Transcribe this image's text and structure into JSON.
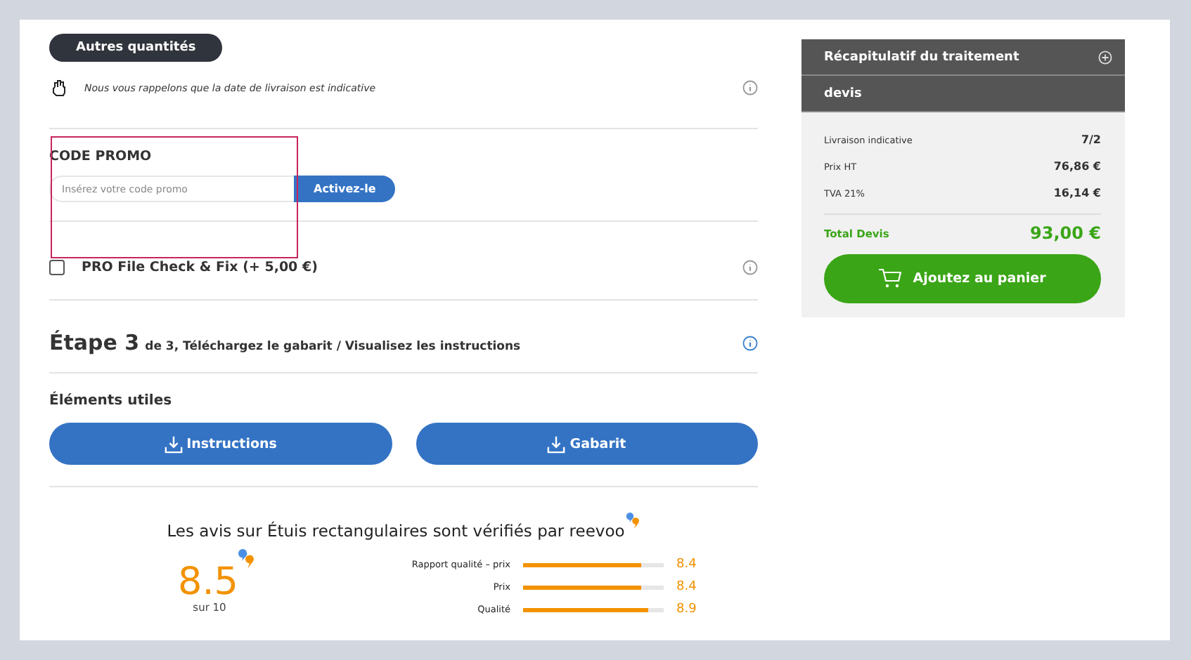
{
  "quantities_button": "Autres quantités",
  "notice": "Nous vous rappelons que la date de livraison est indicative",
  "promo": {
    "title": "CODE PROMO",
    "placeholder": "Insérez votre code promo",
    "button": "Activez-le",
    "highlighted": true
  },
  "option": {
    "label": "PRO File Check & Fix (+ 5,00 €)",
    "checked": false
  },
  "step": {
    "number": "Étape 3",
    "subtitle": "de 3, Téléchargez le gabarit / Visualisez les instructions"
  },
  "useful": {
    "title": "Éléments utiles",
    "buttons": [
      "Instructions",
      "Gabarit"
    ]
  },
  "reviews": {
    "title": "Les avis sur Étuis rectangulaires sont vérifiés par reevoo",
    "score": "8.5",
    "scale": "sur 10",
    "criteria": [
      {
        "label": "Rapport qualité – prix",
        "level": 0.84,
        "value": "8.4"
      },
      {
        "label": "Prix",
        "level": 0.84,
        "value": "8.4"
      },
      {
        "label": "Qualité",
        "level": 0.89,
        "value": "8.9"
      }
    ]
  },
  "summary": {
    "title": "Récapitulatif du traitement",
    "subtitle": "devis",
    "rows": [
      {
        "label": "Livraison indicative",
        "value": "7/2"
      },
      {
        "label": "Prix HT",
        "value": "76,86 €"
      },
      {
        "label": "TVA 21%",
        "value": "16,14 €"
      }
    ],
    "total_label": "Total Devis",
    "total_value": "93,00 €",
    "cart_button": "Ajoutez au panier"
  }
}
